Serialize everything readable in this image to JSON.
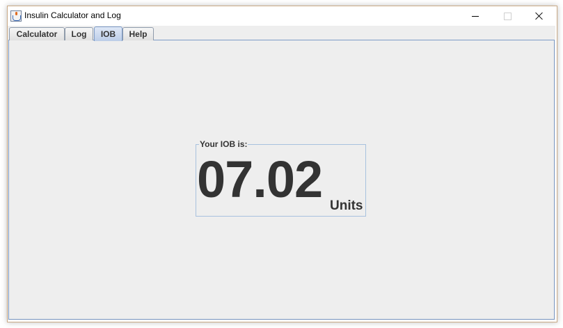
{
  "window": {
    "title": "Insulin Calculator and Log",
    "icon": "java-cup-icon",
    "controls": [
      "minimize",
      "maximize",
      "close"
    ]
  },
  "tabs": [
    {
      "label": "Calculator",
      "active": false
    },
    {
      "label": "Log",
      "active": false
    },
    {
      "label": "IOB",
      "active": true
    },
    {
      "label": "Help",
      "active": false
    }
  ],
  "iob": {
    "legend": "Your IOB is:",
    "value": "07.02",
    "units": "Units"
  },
  "colors": {
    "accent_border": "#7c9ac6",
    "text": "#333333",
    "panel_bg": "#eeeeee"
  }
}
